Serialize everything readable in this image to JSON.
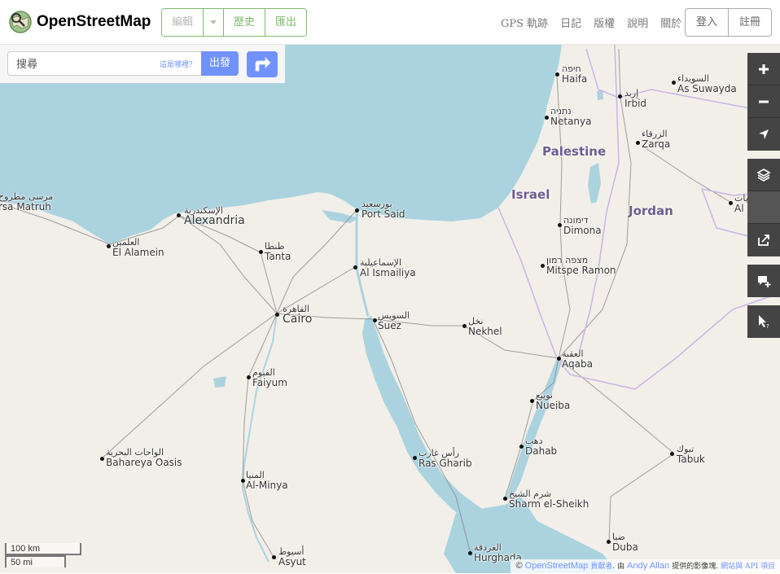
{
  "header": {
    "brand": "OpenStreetMap",
    "edit_label": "編輯",
    "history_label": "歷史",
    "export_label": "匯出",
    "nav_links": [
      "GPS 軌跡",
      "日記",
      "版權",
      "說明",
      "關於"
    ],
    "login_label": "登入",
    "signup_label": "註冊"
  },
  "search": {
    "placeholder": "搜尋",
    "where_link": "這是哪裡？",
    "go_label": "出發"
  },
  "controls": [
    "zoom-in",
    "zoom-out",
    "locate",
    "layers",
    "share",
    "note",
    "query"
  ],
  "scale": {
    "km": "100 km",
    "mi": "50 mi"
  },
  "attribution": {
    "copyright": "©",
    "osm": "OpenStreetMap",
    "contributors": "貢獻者",
    "by": ". 由",
    "author": "Andy Allan",
    "provided": "提供的影像塊.",
    "website_api": "網站與 API 項目"
  },
  "countries": {
    "palestine": "Palestine",
    "israel": "Israel",
    "jordan": "Jordan"
  },
  "places": [
    {
      "key": "haifa",
      "native": "חיפה",
      "latin": "Haifa"
    },
    {
      "key": "netanya",
      "native": "נתניה",
      "latin": "Netanya"
    },
    {
      "key": "irbid",
      "native": "إربد",
      "latin": "Irbid"
    },
    {
      "key": "suwayda",
      "native": "السويداء",
      "latin": "As Suwayda"
    },
    {
      "key": "zarqa",
      "native": "الزرقاء",
      "latin": "Zarqa"
    },
    {
      "key": "qurayyat",
      "native": "القريات",
      "latin": "Al Qurayy"
    },
    {
      "key": "matruh",
      "native": "مرسى مطروح",
      "latin": "rsa Matruh"
    },
    {
      "key": "alexandria",
      "native": "الإسكندرية",
      "latin": "Alexandria"
    },
    {
      "key": "alamein",
      "native": "العلمين",
      "latin": "El Alamein"
    },
    {
      "key": "portsaid",
      "native": "بورسعيد",
      "latin": "Port Said"
    },
    {
      "key": "dimona",
      "native": "דימונה",
      "latin": "Dimona"
    },
    {
      "key": "tanta",
      "native": "طنطا",
      "latin": "Tanta"
    },
    {
      "key": "ismailiya",
      "native": "الإسماعيلية",
      "latin": "Al Ismailiya"
    },
    {
      "key": "mitspe",
      "native": "מצפה רמון",
      "latin": "Mitspe Ramon"
    },
    {
      "key": "cairo",
      "native": "القاهرة",
      "latin": "Cairo"
    },
    {
      "key": "suez",
      "native": "السويس",
      "latin": "Suez"
    },
    {
      "key": "nekhel",
      "native": "نخل",
      "latin": "Nekhel"
    },
    {
      "key": "aqaba",
      "native": "العقبة",
      "latin": "Aqaba"
    },
    {
      "key": "faiyum",
      "native": "الفيوم",
      "latin": "Faiyum"
    },
    {
      "key": "nueiba",
      "native": "نويبع",
      "latin": "Nueiba"
    },
    {
      "key": "bahareya",
      "native": "الواحات البحرية",
      "latin": "Bahareya Oasis"
    },
    {
      "key": "rasgharib",
      "native": "رأس غارب",
      "latin": "Ras Gharib"
    },
    {
      "key": "dahab",
      "native": "دهب",
      "latin": "Dahab"
    },
    {
      "key": "tabuk",
      "native": "تبوك",
      "latin": "Tabuk"
    },
    {
      "key": "minya",
      "native": "المنيا",
      "latin": "Al-Minya"
    },
    {
      "key": "sharm",
      "native": "شرم الشيخ",
      "latin": "Sharm el-Sheikh"
    },
    {
      "key": "duba",
      "native": "ضبا",
      "latin": "Duba"
    },
    {
      "key": "hurghada",
      "native": "الغردقة",
      "latin": "Hurghada"
    },
    {
      "key": "asyut",
      "native": "أسيوط",
      "latin": "Asyut"
    }
  ]
}
